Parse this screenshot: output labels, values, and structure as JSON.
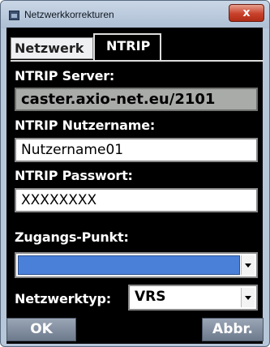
{
  "window": {
    "title": "Netzwerkkorrekturen",
    "close_label": "x"
  },
  "tabs": [
    {
      "label": "Netzwerk",
      "active": false
    },
    {
      "label": "NTRIP",
      "active": true
    }
  ],
  "form": {
    "server_label": "NTRIP Server:",
    "server_value": "caster.axio-net.eu/2101",
    "username_label": "NTRIP Nutzername:",
    "username_value": "Nutzername01",
    "password_label": "NTRIP Passwort:",
    "password_value": "XXXXXXXX",
    "access_point_label": "Zugangs-Punkt:",
    "access_point_value": "",
    "network_type_label": "Netzwerktyp:",
    "network_type_value": "VRS"
  },
  "buttons": {
    "ok": "OK",
    "cancel": "Abbr."
  },
  "colors": {
    "panel_bg": "#000000",
    "window_frame": "#b7c7da",
    "selection": "#4a80d8",
    "close": "#c8402a"
  }
}
